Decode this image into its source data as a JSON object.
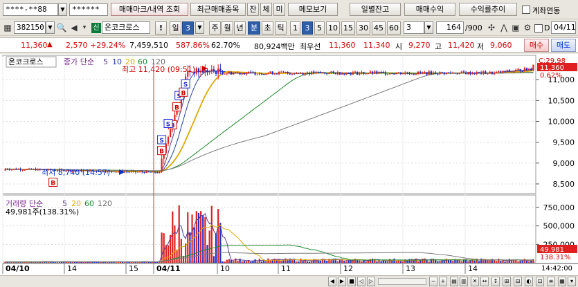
{
  "toolbar1": {
    "account": "****-**88",
    "password": "******",
    "trade_mark_button": "매매마크/내역 조회",
    "recent_button": "최근매매종목",
    "jan": "잔",
    "che": "체",
    "mi": "미",
    "memo_button": "메모보기",
    "daily_balance_button": "일별잔고",
    "trade_profit_button": "매매수익",
    "profit_trend_button": "수익률추이",
    "account_link_label": "계좌연동"
  },
  "toolbar2": {
    "code": "382150",
    "sin_badge": "신",
    "stock_name": "온코크로스",
    "exclaim": "!",
    "period_il": "일",
    "period_num": "3",
    "periods": [
      "주",
      "월",
      "년",
      "분",
      "초",
      "틱"
    ],
    "intervals": [
      "1",
      "3",
      "5",
      "10",
      "15",
      "30",
      "45",
      "60"
    ],
    "interval_selected": "3",
    "dropdown_value": "3",
    "count": "164",
    "count_total": "/900",
    "d_label": "D",
    "date": "04/11"
  },
  "price_bar": {
    "price": "11,360",
    "change": "2,570",
    "change_pct": "+29.24%",
    "volume": "7,459,510",
    "vol_ratio": "587.86%",
    "turnover": "62.70%",
    "trade_value": "80,924백만",
    "best_ask_label": "최우선",
    "best_ask": "11,360",
    "best_bid": "11,340",
    "open_label": "시",
    "open": "9,270",
    "high_label": "고",
    "high": "11,420",
    "low_label": "저",
    "low": "9,060",
    "buy_button": "매수",
    "sell_button": "매도"
  },
  "chart_data": {
    "type": "candlestick",
    "stock_label": "온코크로스",
    "price_legend": {
      "label": "종가 단순",
      "periods": [
        "5",
        "10",
        "20",
        "60",
        "120"
      ]
    },
    "volume_legend": {
      "label": "거래량 단순",
      "periods": [
        "5",
        "20",
        "60",
        "120"
      ]
    },
    "volume_info": "49,981주(138.31%)",
    "high_annotation": "최고 11,420 (09:51)",
    "low_annotation": "최저 8,740 (14:57)",
    "top_right_label": "C:29.98",
    "price_axis": {
      "ticks": [
        11000,
        10500,
        10000,
        9500,
        9000,
        8500
      ],
      "labels": [
        "11,000",
        "10,500",
        "10,000",
        "9,500",
        "9,000",
        "8,500"
      ],
      "range": [
        8300,
        11550
      ]
    },
    "current_price_tag": "11,360",
    "current_pct_tag": "0.62%",
    "volume_axis": {
      "ticks": [
        750000,
        500000,
        250000
      ],
      "labels": [
        "750,000",
        "500,000",
        "250,000"
      ],
      "range": [
        0,
        900000
      ]
    },
    "current_volume_tag": "49,981",
    "current_vol_pct_tag": "138.31%",
    "x_labels": [
      "04/10",
      "14",
      "15",
      "04/11",
      "10",
      "11",
      "12",
      "13",
      "14"
    ],
    "time_tag": "14:42:00",
    "colors": {
      "up": "#e02020",
      "down": "#1a2ccf",
      "ma5": "#5b3a8c",
      "ma10": "#1e3fa8",
      "ma20": "#e0a800",
      "ma60": "#1b8a2a",
      "ma120": "#7a7a7a"
    }
  }
}
